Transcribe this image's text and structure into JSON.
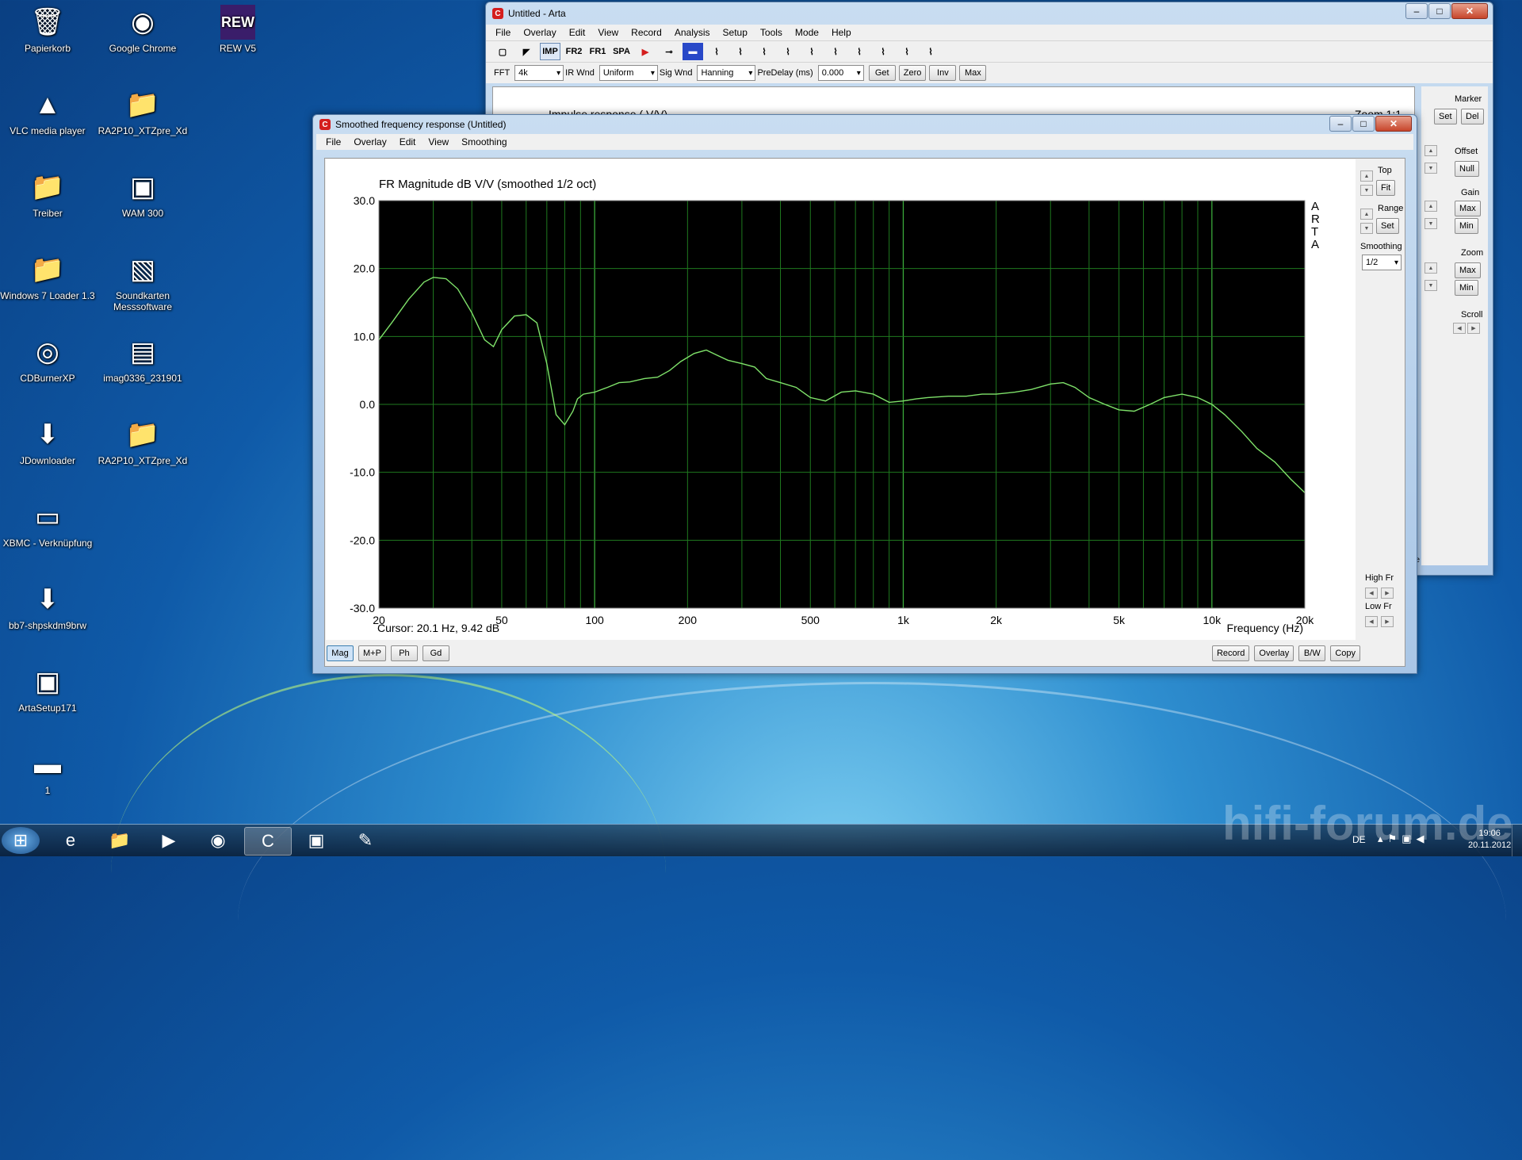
{
  "desktop_icons": [
    {
      "label": "Papierkorb",
      "icon": "recycle-bin-icon",
      "glyph": "🗑"
    },
    {
      "label": "Google Chrome",
      "icon": "chrome-icon",
      "glyph": "◉"
    },
    {
      "label": "REW V5",
      "icon": "rew-icon",
      "glyph": "REW"
    },
    {
      "label": "VLC media player",
      "icon": "vlc-icon",
      "glyph": "▲"
    },
    {
      "label": "RA2P10_XTZpre_Xd",
      "icon": "folder-icon",
      "glyph": "📁"
    },
    {
      "label": "Treiber",
      "icon": "folder-icon",
      "glyph": "📁"
    },
    {
      "label": "WAM 300",
      "icon": "wam-icon",
      "glyph": "▣"
    },
    {
      "label": "Windows 7 Loader 1.3",
      "icon": "folder-icon",
      "glyph": "📁"
    },
    {
      "label": "Soundkarten Messsoftware",
      "icon": "soundcard-icon",
      "glyph": "▧"
    },
    {
      "label": "CDBurnerXP",
      "icon": "cdburner-icon",
      "glyph": "◎"
    },
    {
      "label": "imag0336_231901",
      "icon": "image-file-icon",
      "glyph": "▤"
    },
    {
      "label": "JDownloader",
      "icon": "jdownloader-icon",
      "glyph": "⬇"
    },
    {
      "label": "RA2P10_XTZpre_Xd",
      "icon": "folder-icon",
      "glyph": "📁"
    },
    {
      "label": "XBMC - Verknüpfung",
      "icon": "xbmc-icon",
      "glyph": "▭"
    },
    {
      "label": "bb7-shpskdm9brw",
      "icon": "app-icon",
      "glyph": "⬇"
    },
    {
      "label": "ArtaSetup171",
      "icon": "installer-icon",
      "glyph": "▣"
    },
    {
      "label": "1",
      "icon": "file-icon",
      "glyph": "▬"
    }
  ],
  "arta_window": {
    "title": "Untitled - Arta",
    "menu": [
      "File",
      "Overlay",
      "Edit",
      "View",
      "Record",
      "Analysis",
      "Setup",
      "Tools",
      "Mode",
      "Help"
    ],
    "toolbar": [
      "IMP",
      "FR2",
      "FR1",
      "SPA"
    ],
    "fft_label": "FFT",
    "fft_value": "4k",
    "irwnd_label": "IR Wnd",
    "irwnd_value": "Uniform",
    "sigwnd_label": "Sig Wnd",
    "sigwnd_value": "Hanning",
    "predelay_label": "PreDelay (ms)",
    "predelay_value": "0.000",
    "buttons": [
      "Get",
      "Zero",
      "Inv",
      "Max"
    ],
    "behind_title": "Impulse response ( V/V)",
    "behind_zoom": "Zoom 1:1",
    "marker_label": "Marker",
    "marker_set": "Set",
    "marker_del": "Del",
    "offset_label": "Offset",
    "offset_null": "Null",
    "gain_label": "Gain",
    "gain_max": "Max",
    "gain_min": "Min",
    "zoom_label": "Zoom",
    "zoom_max": "Max",
    "zoom_min": "Min",
    "scroll_label": "Scroll",
    "status_fragment": "ase"
  },
  "fr_window": {
    "title": "Smoothed frequency response (Untitled)",
    "menu": [
      "File",
      "Overlay",
      "Edit",
      "View",
      "Smoothing"
    ],
    "top_label": "Top",
    "fit_btn": "Fit",
    "range_label": "Range",
    "set_btn": "Set",
    "smoothing_label": "Smoothing",
    "smoothing_value": "1/2",
    "highfr_label": "High Fr",
    "lowfr_label": "Low Fr",
    "cursor_text": "Cursor: 20.1 Hz, 9.42 dB",
    "bottom_left_buttons": [
      "Mag",
      "M+P",
      "Ph",
      "Gd"
    ],
    "bottom_right_buttons": [
      "Record",
      "Overlay",
      "B/W",
      "Copy"
    ]
  },
  "chart_data": {
    "type": "line",
    "title": "FR Magnitude dB V/V (smoothed 1/2 oct)",
    "xlabel": "Frequency (Hz)",
    "ylabel": "",
    "watermark": "ARTA",
    "x_scale": "log",
    "xlim": [
      20,
      20000
    ],
    "ylim": [
      -30,
      30
    ],
    "x_ticks": [
      20,
      50,
      100,
      200,
      500,
      1000,
      2000,
      5000,
      10000,
      20000
    ],
    "x_tick_labels": [
      "20",
      "50",
      "100",
      "200",
      "500",
      "1k",
      "2k",
      "5k",
      "10k",
      "20k"
    ],
    "y_ticks": [
      30,
      20,
      10,
      0,
      -10,
      -20,
      -30
    ],
    "y_tick_labels": [
      "30.0",
      "20.0",
      "10.0",
      "0.0",
      "-10.0",
      "-20.0",
      "-30.0"
    ],
    "grid": true,
    "background": "#000000",
    "grid_color": "#1f7a1f",
    "line_color": "#7fe26a",
    "series": [
      {
        "x": [
          20,
          22,
          25,
          28,
          30,
          33,
          36,
          40,
          44,
          47,
          50,
          55,
          60,
          65,
          70,
          75,
          80,
          85,
          88,
          92,
          100,
          110,
          120,
          130,
          145,
          160,
          175,
          190,
          210,
          230,
          250,
          270,
          300,
          330,
          360,
          400,
          450,
          500,
          560,
          630,
          700,
          800,
          900,
          1000,
          1100,
          1200,
          1400,
          1600,
          1800,
          2000,
          2300,
          2600,
          3000,
          3300,
          3600,
          4000,
          4500,
          5000,
          5600,
          6300,
          7000,
          8000,
          9000,
          10000,
          11000,
          12500,
          14000,
          16000,
          18000,
          20000
        ],
        "y": [
          9.5,
          12,
          15.5,
          18,
          18.7,
          18.5,
          17,
          13.5,
          9.5,
          8.5,
          11,
          13,
          13.2,
          12,
          6,
          -1.5,
          -3,
          -1,
          0.8,
          1.5,
          1.8,
          2.5,
          3.2,
          3.3,
          3.8,
          4,
          5,
          6.3,
          7.5,
          8,
          7.2,
          6.5,
          6,
          5.5,
          3.8,
          3.2,
          2.5,
          1,
          0.5,
          1.8,
          2,
          1.5,
          0.3,
          0.5,
          0.8,
          1,
          1.2,
          1.2,
          1.5,
          1.5,
          1.8,
          2.2,
          3,
          3.2,
          2.5,
          1,
          0,
          -0.8,
          -1,
          0,
          1,
          1.5,
          1,
          0,
          -1.5,
          -4,
          -6.5,
          -8.5,
          -11,
          -13
        ]
      }
    ]
  },
  "taskbar": {
    "apps": [
      "start-orb",
      "ie-icon",
      "explorer-icon",
      "media-player-icon",
      "chrome-icon",
      "arta-icon",
      "wam-icon",
      "paint-icon"
    ],
    "lang": "DE",
    "time": "19:06",
    "date": "20.11.2012",
    "watermark": "hifi-forum.de"
  }
}
